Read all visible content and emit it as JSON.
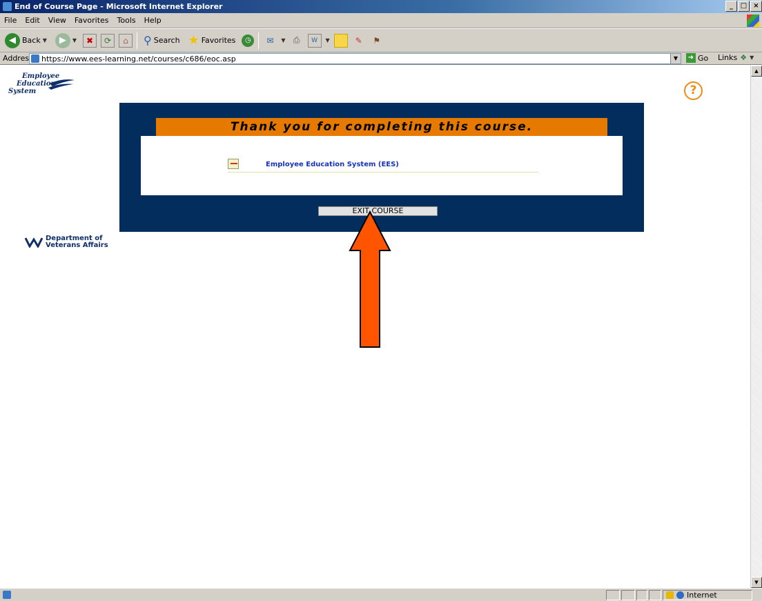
{
  "window": {
    "title": "End of Course Page - Microsoft Internet Explorer",
    "controls": [
      "_",
      "□",
      "×"
    ]
  },
  "menubar": {
    "items": [
      "File",
      "Edit",
      "View",
      "Favorites",
      "Tools",
      "Help"
    ]
  },
  "toolbar": {
    "back_label": "Back",
    "search_label": "Search",
    "favorites_label": "Favorites"
  },
  "addressbar": {
    "label": "Address",
    "url": "https://www.ees-learning.net/courses/c686/eoc.asp",
    "go_label": "Go",
    "links_label": "Links"
  },
  "page": {
    "logo_text": [
      "Employee",
      "Education",
      "System"
    ],
    "help_symbol": "?",
    "va_logo_text": [
      "Department of",
      "Veterans Affairs"
    ],
    "banner_text": "Thank you for completing this course.",
    "course_link": "Employee Education System (EES)",
    "exit_button": "EXIT COURSE"
  },
  "statusbar": {
    "zone_label": "Internet"
  },
  "colors": {
    "panel": "#032d5c",
    "banner": "#e67a00",
    "arrow": "#ff5500",
    "link": "#1533bd"
  }
}
